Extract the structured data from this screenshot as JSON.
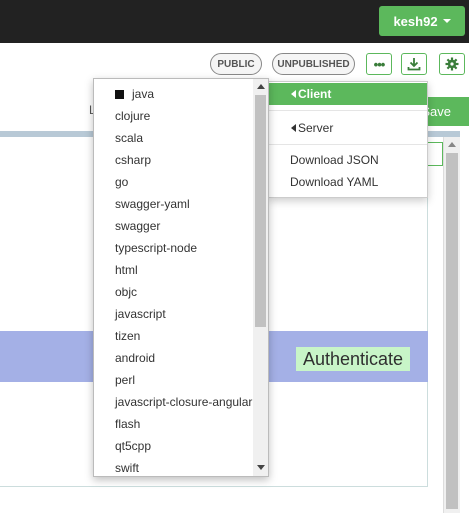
{
  "header": {
    "user_menu_label": "kesh92"
  },
  "toolbar": {
    "public_badge": "PUBLIC",
    "unpublished_badge": "UNPUBLISHED",
    "more_label": "•••",
    "save_label": "Save",
    "left_label": "L"
  },
  "generate_menu": {
    "client_label": "Client",
    "server_label": "Server",
    "download_json_label": "Download JSON",
    "download_yaml_label": "Download YAML"
  },
  "language_menu": {
    "selected": "java",
    "items": [
      "java",
      "clojure",
      "scala",
      "csharp",
      "go",
      "swagger-yaml",
      "swagger",
      "typescript-node",
      "html",
      "objc",
      "javascript",
      "tizen",
      "android",
      "perl",
      "javascript-closure-angular",
      "flash",
      "qt5cpp",
      "swift"
    ]
  },
  "content": {
    "authenticate_label": "Authenticate"
  },
  "colors": {
    "accent_green": "#5cb85c",
    "topbar": "#222222",
    "auth_bar": "#a4b0e6",
    "auth_label_bg": "#c8f5c8"
  }
}
